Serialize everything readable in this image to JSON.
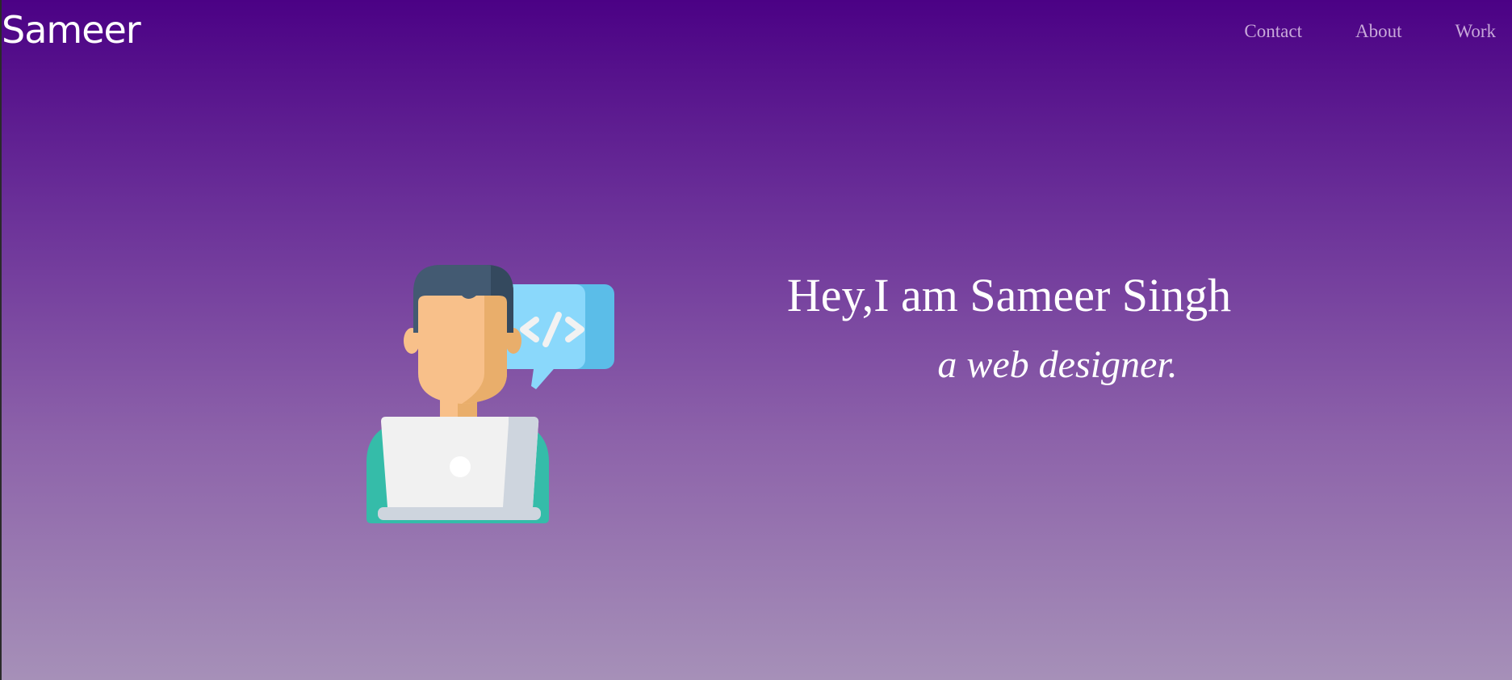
{
  "header": {
    "logo": "Sameer",
    "nav": [
      {
        "label": "Contact"
      },
      {
        "label": "About"
      },
      {
        "label": "Work"
      }
    ]
  },
  "hero": {
    "title": "Hey,I am Sameer Singh",
    "subtitle": "a web designer.",
    "illustration_icon": "developer-with-laptop-code-bubble-icon"
  },
  "colors": {
    "gradient_top": "#4b0185",
    "gradient_bottom": "#a690b8",
    "nav_text": "#c7a8d9",
    "text": "#ffffff"
  }
}
